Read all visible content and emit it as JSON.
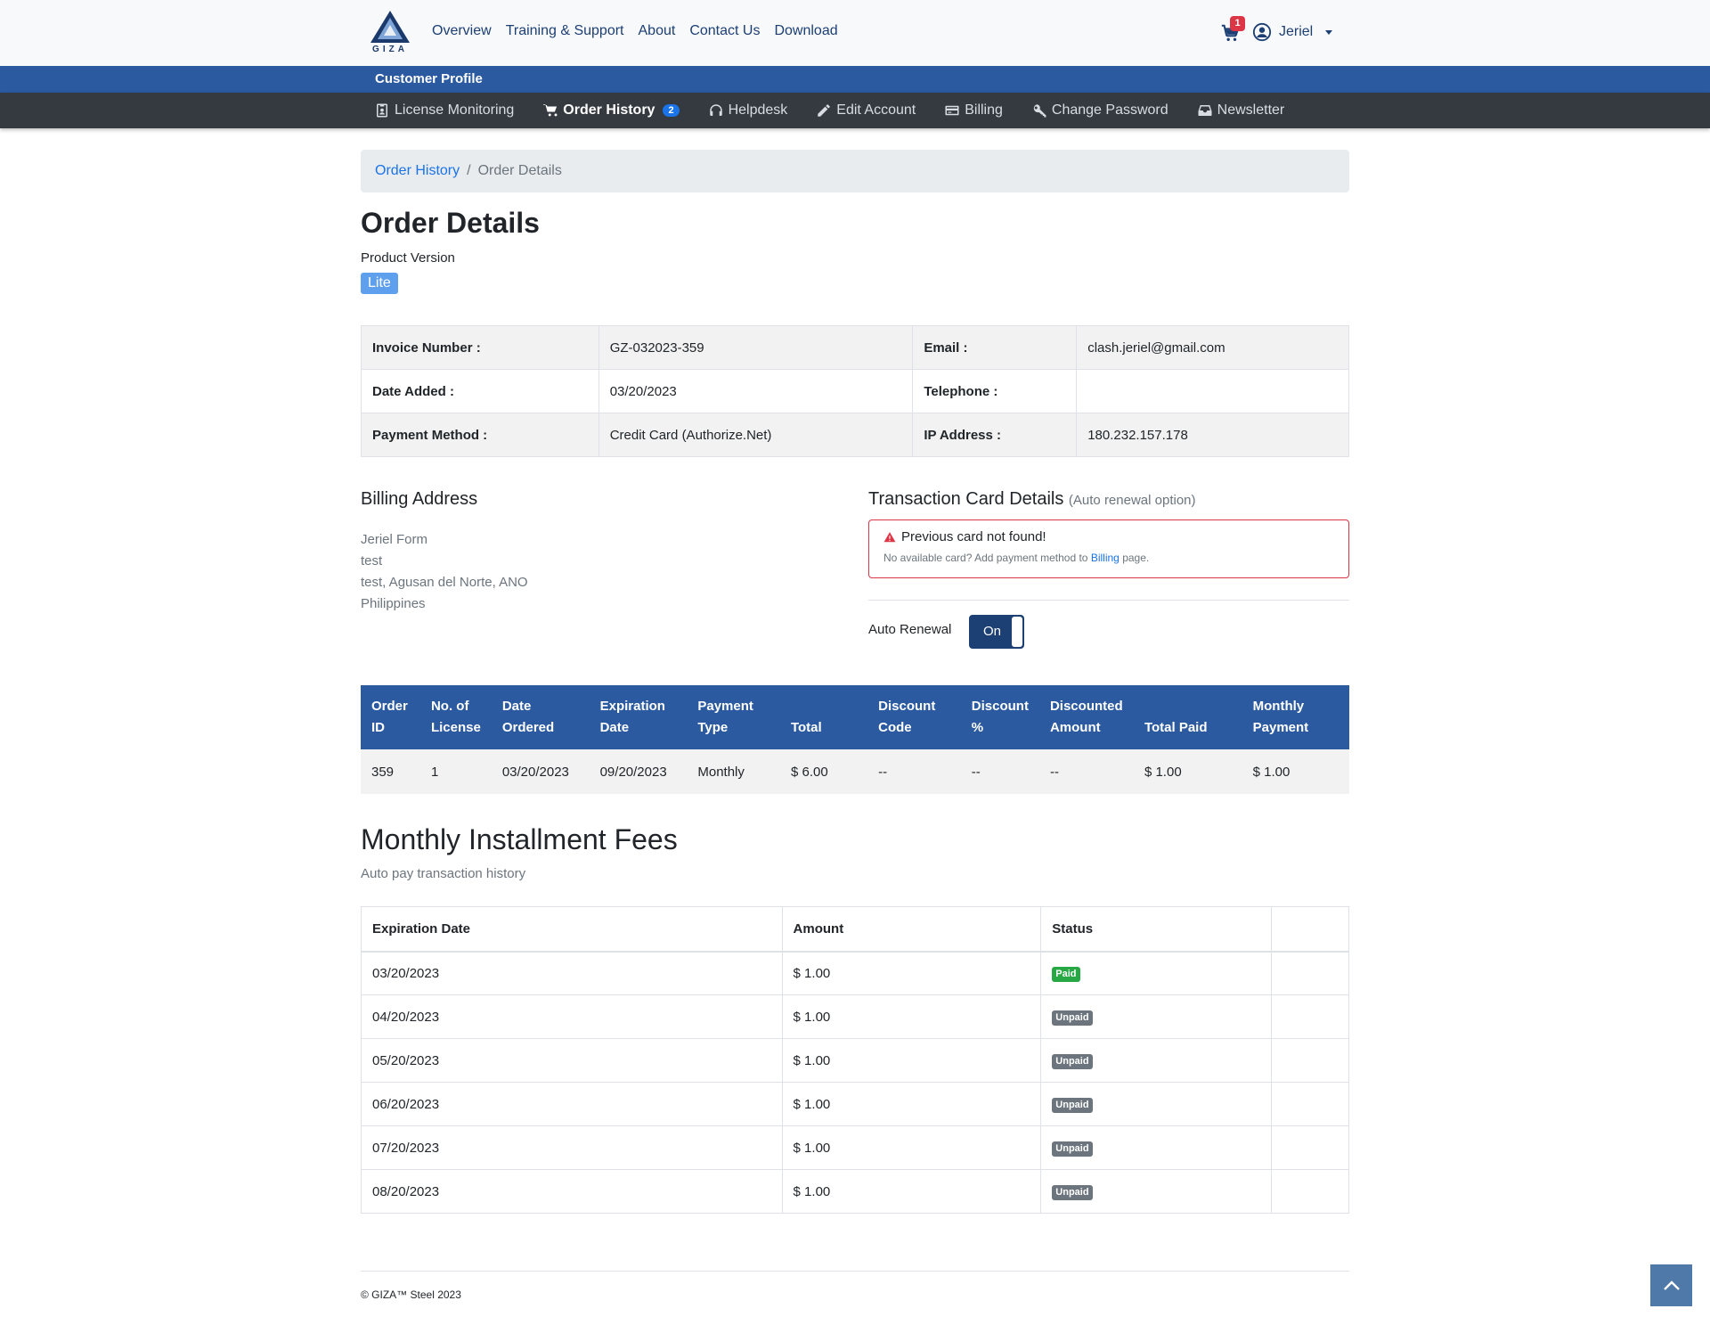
{
  "brand": {
    "logo_text": "GIZA"
  },
  "nav": {
    "links": [
      "Overview",
      "Training & Support",
      "About",
      "Contact Us",
      "Download"
    ],
    "cart_count": "1",
    "user_name": "Jeriel"
  },
  "profile_bar": {
    "title": "Customer Profile"
  },
  "subnav": {
    "items": [
      {
        "label": "License Monitoring",
        "icon": "id-badge-icon"
      },
      {
        "label": "Order History",
        "icon": "cart-icon",
        "badge": "2",
        "active": true
      },
      {
        "label": "Helpdesk",
        "icon": "headset-icon"
      },
      {
        "label": "Edit Account",
        "icon": "pencil-icon"
      },
      {
        "label": "Billing",
        "icon": "credit-card-icon"
      },
      {
        "label": "Change Password",
        "icon": "key-icon"
      },
      {
        "label": "Newsletter",
        "icon": "inbox-icon"
      }
    ]
  },
  "breadcrumb": {
    "parent": "Order History",
    "current": "Order Details"
  },
  "page": {
    "title": "Order Details",
    "product_version_label": "Product Version",
    "product_version": "Lite"
  },
  "info": {
    "invoice_label": "Invoice Number :",
    "invoice": "GZ-032023-359",
    "email_label": "Email :",
    "email": "clash.jeriel@gmail.com",
    "date_label": "Date Added :",
    "date": "03/20/2023",
    "phone_label": "Telephone :",
    "phone": "",
    "payment_label": "Payment Method :",
    "payment": "Credit Card (Authorize.Net)",
    "ip_label": "IP Address :",
    "ip": "180.232.157.178"
  },
  "billing": {
    "title": "Billing Address",
    "lines": [
      "Jeriel Form",
      "test",
      "test, Agusan del Norte, ANO",
      "Philippines"
    ]
  },
  "card": {
    "title": "Transaction Card Details",
    "subtitle": "(Auto renewal option)",
    "alert_title": "Previous card not found!",
    "alert_text": "No available card? Add payment method to",
    "alert_link": "Billing",
    "alert_suffix": "page.",
    "auto_renewal_label": "Auto Renewal",
    "toggle_label": "On"
  },
  "order_table": {
    "headers": [
      [
        "Order",
        "ID"
      ],
      [
        "No. of",
        "License"
      ],
      [
        "Date",
        "Ordered"
      ],
      [
        "Expiration",
        "Date"
      ],
      [
        "Payment",
        "Type"
      ],
      [
        "",
        "Total"
      ],
      [
        "Discount",
        "Code"
      ],
      [
        "Discount",
        "%"
      ],
      [
        "Discounted",
        "Amount"
      ],
      [
        "",
        "Total Paid"
      ],
      [
        "Monthly",
        "Payment"
      ]
    ],
    "row": [
      "359",
      "1",
      "03/20/2023",
      "09/20/2023",
      "Monthly",
      "$ 6.00",
      "--",
      "--",
      "--",
      "$ 1.00",
      "$ 1.00"
    ]
  },
  "installments": {
    "title": "Monthly Installment Fees",
    "subtitle": "Auto pay transaction history",
    "headers": [
      "Expiration Date",
      "Amount",
      "Status",
      ""
    ],
    "rows": [
      {
        "date": "03/20/2023",
        "amount": "$ 1.00",
        "status": "Paid"
      },
      {
        "date": "04/20/2023",
        "amount": "$ 1.00",
        "status": "Unpaid"
      },
      {
        "date": "05/20/2023",
        "amount": "$ 1.00",
        "status": "Unpaid"
      },
      {
        "date": "06/20/2023",
        "amount": "$ 1.00",
        "status": "Unpaid"
      },
      {
        "date": "07/20/2023",
        "amount": "$ 1.00",
        "status": "Unpaid"
      },
      {
        "date": "08/20/2023",
        "amount": "$ 1.00",
        "status": "Unpaid"
      }
    ]
  },
  "footer": {
    "text": "© GIZA™ Steel 2023"
  },
  "colors": {
    "primary": "#2b5aa0",
    "dark_nav": "#343a40",
    "link": "#1a73e8",
    "danger": "#dc3545",
    "success": "#28a745"
  }
}
